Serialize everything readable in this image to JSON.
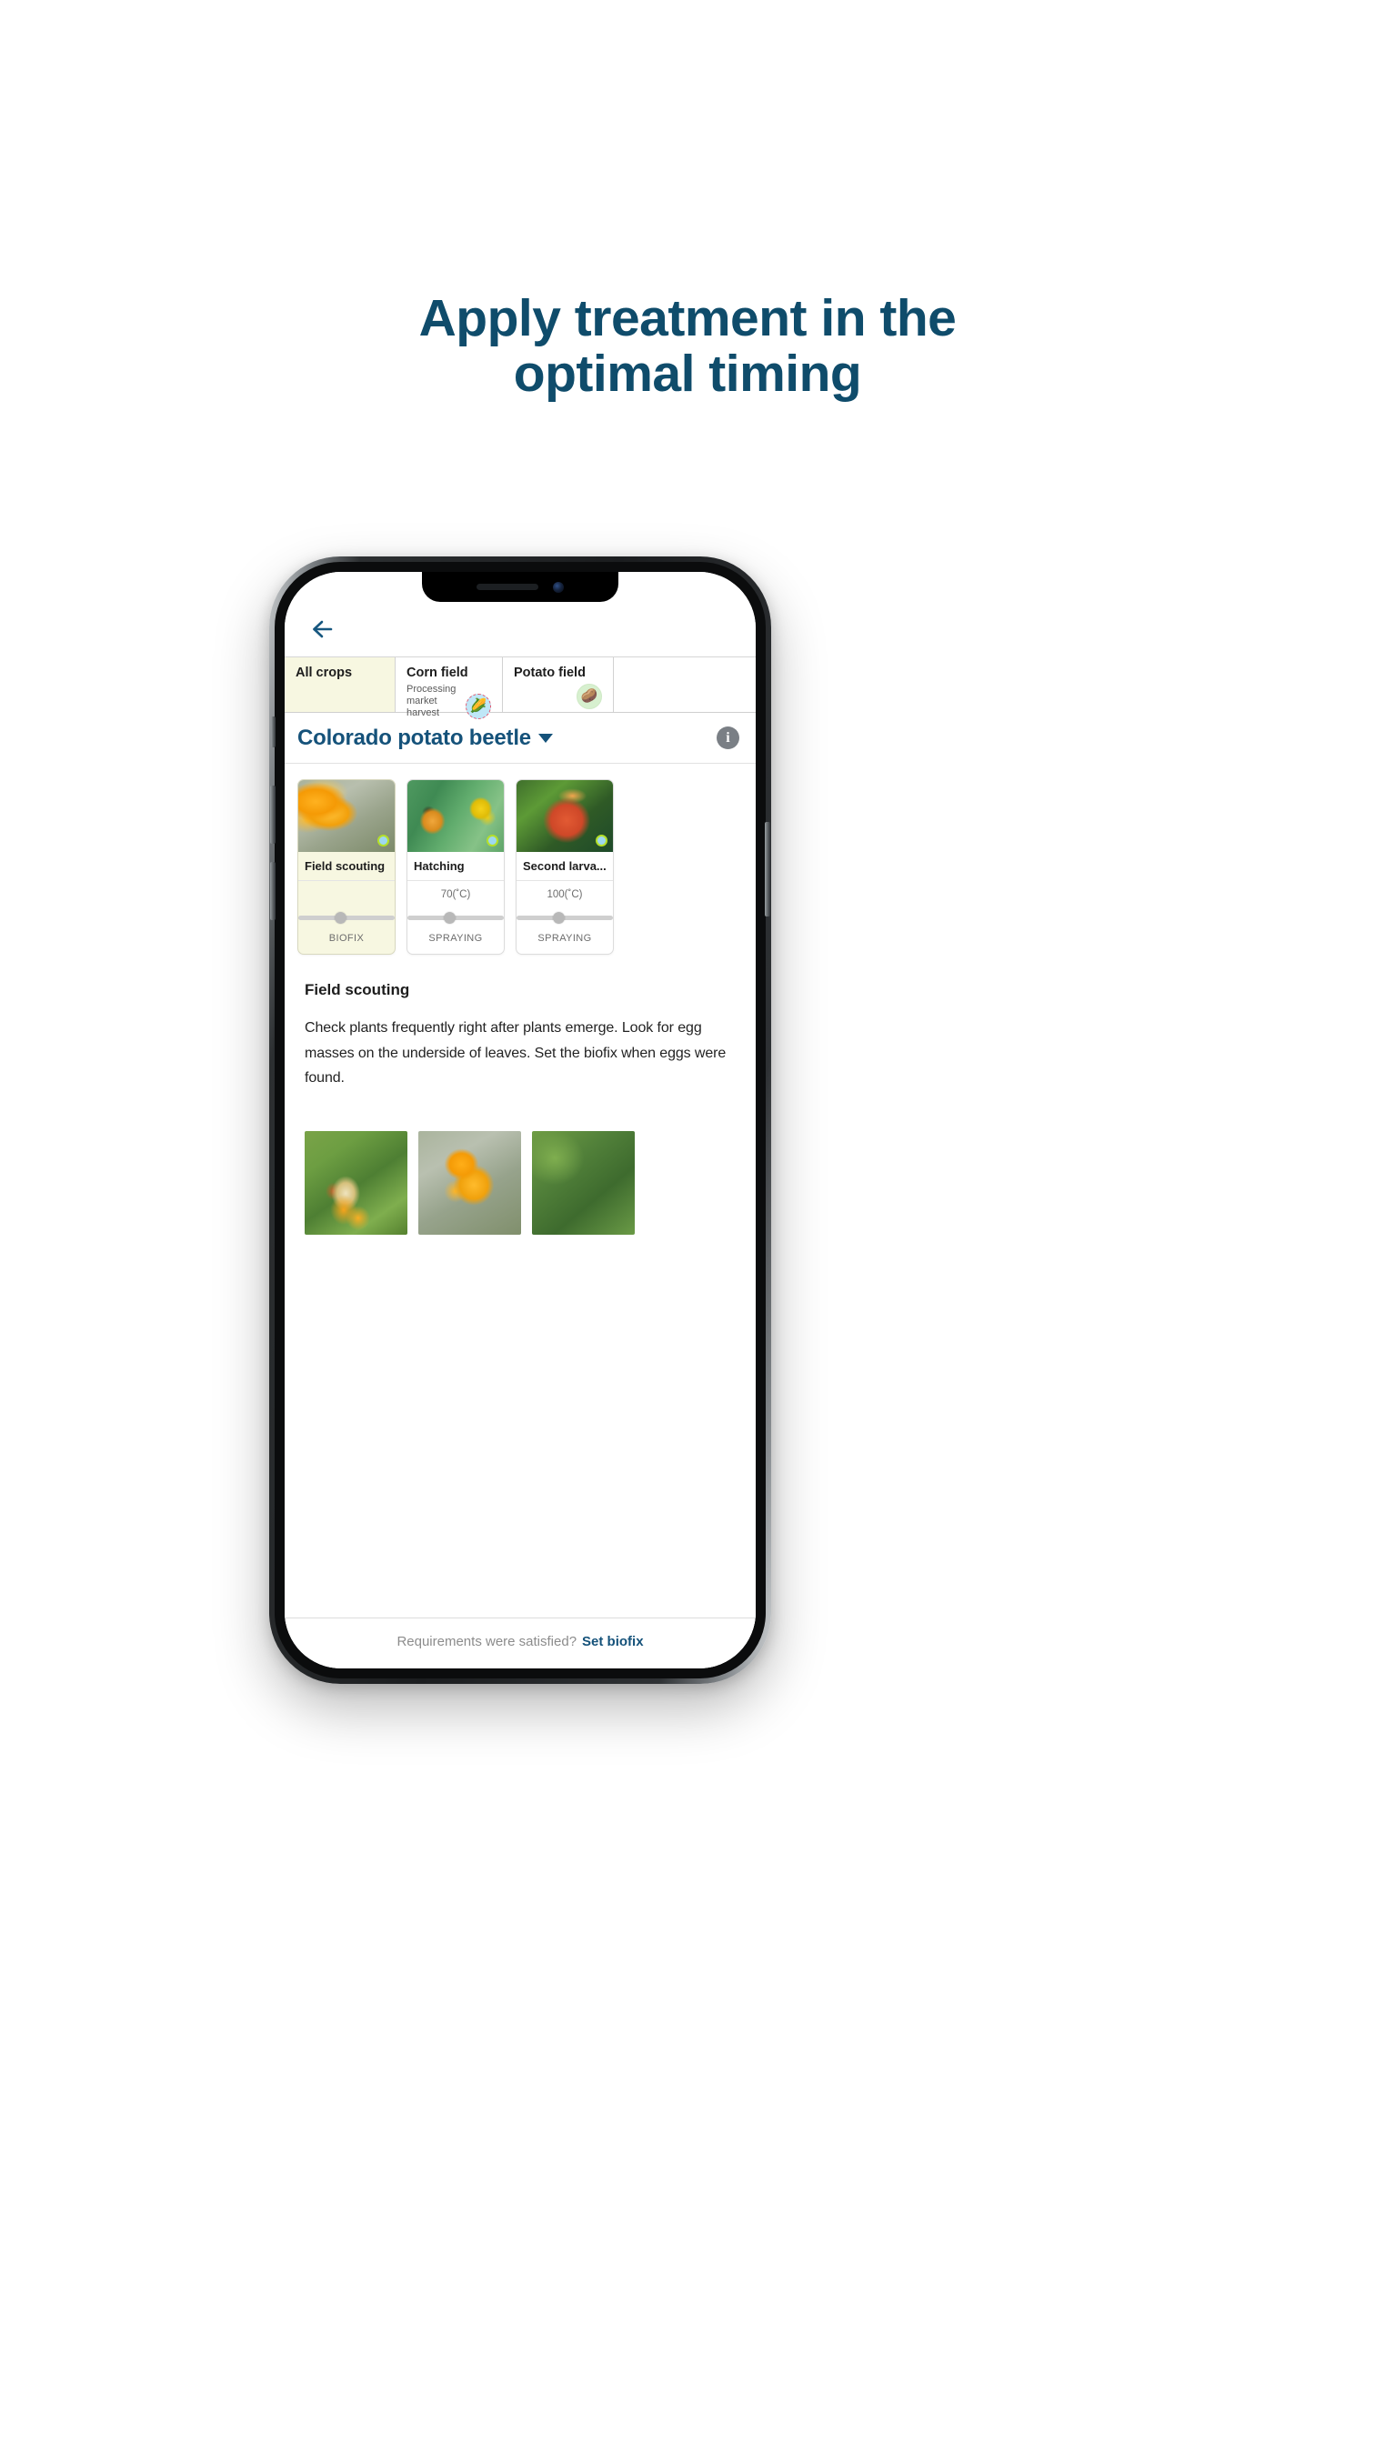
{
  "headline": {
    "line1": "Apply treatment in the",
    "line2": "optimal timing",
    "color": "#0f4c6b"
  },
  "app": {
    "back_icon": "back-arrow-icon",
    "tabs": [
      {
        "title": "All crops",
        "subtitle": "",
        "badge": "",
        "selected": true
      },
      {
        "title": "Corn field",
        "subtitle": "Processing market harvest",
        "badge": "🌽",
        "selected": false
      },
      {
        "title": "Potato field",
        "subtitle": "",
        "badge": "🥔",
        "selected": false
      }
    ],
    "pest": {
      "name": "Colorado potato beetle",
      "caret_icon": "chevron-down-icon",
      "info_icon": "info-icon"
    },
    "stages": [
      {
        "name": "Field scouting",
        "gdd": "",
        "action": "BIOFIX",
        "active": true,
        "photo": "ph-eggs",
        "dot": true,
        "knob_pct": "38%"
      },
      {
        "name": "Hatching",
        "gdd": "70(˚C)",
        "action": "SPRAYING",
        "active": false,
        "photo": "ph-larva",
        "dot": true,
        "knob_pct": "38%"
      },
      {
        "name": "Second larva...",
        "gdd": "100(˚C)",
        "action": "SPRAYING",
        "active": false,
        "photo": "ph-beetle",
        "dot": true,
        "knob_pct": "38%"
      }
    ],
    "detail": {
      "title": "Field scouting",
      "body": "Check plants frequently right after plants emerge. Look for egg masses on the underside of leaves. Set the biofix when eggs were found.",
      "gallery": [
        {
          "alt": "adult-colorado-potato-beetle-with-eggs"
        },
        {
          "alt": "orange-egg-mass-on-leaf"
        },
        {
          "alt": "potato-leaf-closeup"
        }
      ]
    },
    "cta": {
      "question": "Requirements were satisfied?",
      "link": "Set biofix"
    }
  }
}
